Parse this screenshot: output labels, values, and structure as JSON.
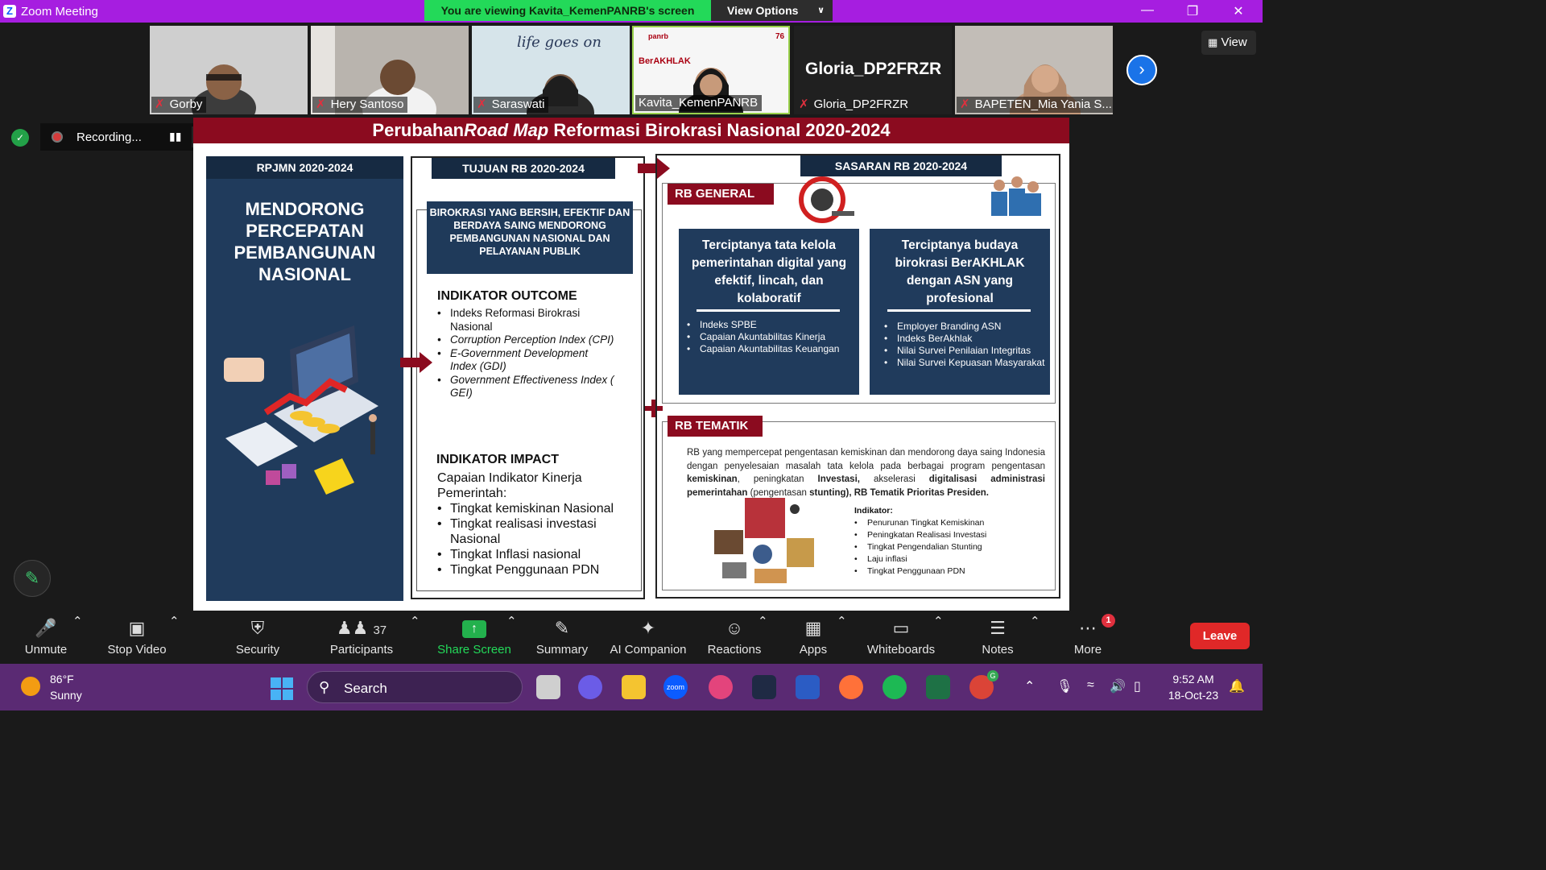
{
  "window": {
    "title": "Zoom Meeting",
    "viewing_banner": "You are viewing Kavita_KemenPANRB's screen",
    "view_options": "View Options"
  },
  "participants": [
    {
      "name": "Gorby",
      "muted": true
    },
    {
      "name": "Hery Santoso",
      "muted": true
    },
    {
      "name": "Saraswati",
      "muted": true
    },
    {
      "name": "Kavita_KemenPANRB",
      "muted": false
    },
    {
      "name": "Gloria_DP2FRZR",
      "muted": true,
      "big_label": "Gloria_DP2FRZR"
    },
    {
      "name": "BAPETEN_Mia Yania S...",
      "muted": true
    }
  ],
  "thumb_texts": {
    "saraswati_bg": "life goes on",
    "kavita_logo1": "panrb",
    "kavita_logo2": "BerAKHLAK",
    "kavita_num": "76"
  },
  "view_button": "View",
  "recording": {
    "label": "Recording...",
    "pause": "▮▮"
  },
  "slide": {
    "title_prefix": "Perubahan",
    "title_italic": "Road Map",
    "title_suffix": " Reformasi Birokrasi Nasional 2020-2024",
    "col1": {
      "header": "RPJMN 2020-2024",
      "l1": "MENDORONG",
      "l2": "PERCEPATAN",
      "l3": "PEMBANGUNAN",
      "l4": "NASIONAL"
    },
    "col2": {
      "header": "TUJUAN RB 2020-2024",
      "tujuan": "BIROKRASI YANG BERSIH, EFEKTIF DAN BERDAYA SAING MENDORONG PEMBANGUNAN NASIONAL DAN PELAYANAN PUBLIK",
      "outcome_title": "INDIKATOR OUTCOME",
      "outcome_items": [
        "Indeks Reformasi Birokrasi Nasional",
        "Corruption Perception Index (CPI)",
        "E-Government  Development Index (GDI)",
        "Government Effectiveness Index ( GEI)"
      ],
      "impact_title": "INDIKATOR IMPACT",
      "impact_intro": "Capaian Indikator Kinerja Pemerintah:",
      "impact_items": [
        "Tingkat kemiskinan Nasional",
        "Tingkat realisasi investasi Nasional",
        "Tingkat Inflasi nasional",
        "Tingkat Penggunaan PDN"
      ]
    },
    "col3": {
      "header": "SASARAN RB 2020-2024",
      "general_label": "RB GENERAL",
      "card1_title": "Terciptanya tata kelola pemerintahan digital yang efektif, lincah, dan kolaboratif",
      "card1_items": [
        "Indeks SPBE",
        "Capaian Akuntabilitas Kinerja",
        "Capaian Akuntabilitas Keuangan"
      ],
      "card2_title": "Terciptanya budaya birokrasi BerAKHLAK dengan ASN yang profesional",
      "card2_items": [
        "Employer Branding ASN",
        "Indeks BerAkhlak",
        "Nilai Survei Penilaian Integritas",
        "Nilai Survei Kepuasan Masyarakat"
      ],
      "tematik_label": "RB TEMATIK",
      "tematik_p1": "RB yang mempercepat pengentasan kemiskinan dan mendorong daya saing Indonesia dengan penyelesaian masalah tata kelola pada berbagai program pengentasan ",
      "tematik_b1": "kemiskinan",
      "tematik_p2": ", peningkatan ",
      "tematik_b2": "Investasi,",
      "tematik_p3": " akselerasi ",
      "tematik_b3": "digitalisasi administrasi pemerintahan",
      "tematik_p4": " (pengentasan ",
      "tematik_b4": "stunting), RB Tematik Prioritas Presiden.",
      "indikator_title": "Indikator:",
      "indikator_items": [
        "Penurunan Tingkat Kemiskinan",
        "Peningkatan Realisasi Investasi",
        "Tingkat Pengendalian Stunting",
        "Laju inflasi",
        "Tingkat Penggunaan PDN"
      ]
    }
  },
  "toolbar": {
    "unmute": "Unmute",
    "stop_video": "Stop Video",
    "security": "Security",
    "participants": "Participants",
    "participants_count": "37",
    "share_screen": "Share Screen",
    "summary": "Summary",
    "ai_companion": "AI Companion",
    "reactions": "Reactions",
    "apps": "Apps",
    "whiteboards": "Whiteboards",
    "notes": "Notes",
    "more": "More",
    "more_badge": "1",
    "leave": "Leave"
  },
  "taskbar": {
    "temp": "86°F",
    "weather": "Sunny",
    "search": "Search",
    "time": "9:52 AM",
    "date": "18-Oct-23",
    "chrome_badge": "G",
    "zoom_label": "zoom"
  },
  "colors": {
    "zoom_purple": "#a61ee0",
    "green_banner": "#23d959",
    "slide_red": "#8b0b1f",
    "slide_navy": "#203b5c",
    "taskbar": "#5a2a73"
  }
}
